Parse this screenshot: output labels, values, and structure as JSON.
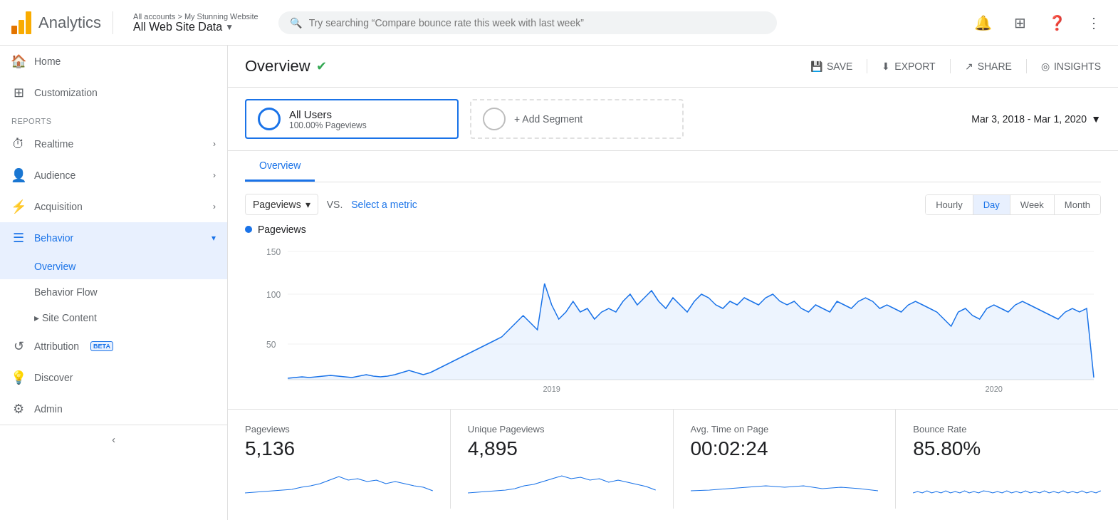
{
  "header": {
    "logo_text": "Analytics",
    "account_path": "All accounts > My Stunning Website",
    "account_name": "All Web Site Data",
    "search_placeholder": "Try searching “Compare bounce rate this week with last week”"
  },
  "sidebar": {
    "nav_items": [
      {
        "id": "home",
        "icon": "🏠",
        "label": "Home",
        "active": false
      },
      {
        "id": "customization",
        "icon": "⊞",
        "label": "Customization",
        "active": false
      }
    ],
    "reports_label": "REPORTS",
    "report_items": [
      {
        "id": "realtime",
        "icon": "⏱",
        "label": "Realtime",
        "expandable": true,
        "active": false
      },
      {
        "id": "audience",
        "icon": "👤",
        "label": "Audience",
        "expandable": true,
        "active": false
      },
      {
        "id": "acquisition",
        "icon": "⚡",
        "label": "Acquisition",
        "expandable": true,
        "active": false
      },
      {
        "id": "behavior",
        "icon": "☰",
        "label": "Behavior",
        "expandable": true,
        "active": true,
        "expanded": true
      }
    ],
    "behavior_sub": [
      {
        "id": "overview",
        "label": "Overview",
        "active": true
      },
      {
        "id": "behavior-flow",
        "label": "Behavior Flow",
        "active": false
      },
      {
        "id": "site-content",
        "label": "▸ Site Content",
        "active": false
      }
    ],
    "bottom_items": [
      {
        "id": "attribution",
        "icon": "↺",
        "label": "Attribution",
        "beta": true
      },
      {
        "id": "discover",
        "icon": "💡",
        "label": "Discover",
        "beta": false
      },
      {
        "id": "admin",
        "icon": "⚙",
        "label": "Admin",
        "beta": false
      }
    ],
    "collapse_label": "‹"
  },
  "overview": {
    "title": "Overview",
    "verified": true,
    "actions": {
      "save": "SAVE",
      "export": "EXPORT",
      "share": "SHARE",
      "insights": "INSIGHTS"
    }
  },
  "segment": {
    "name": "All Users",
    "pct": "100.00% Pageviews",
    "add_label": "+ Add Segment"
  },
  "date_range": "Mar 3, 2018 - Mar 1, 2020",
  "chart": {
    "tab": "Overview",
    "metric_label": "Pageviews",
    "vs_text": "VS.",
    "select_metric": "Select a metric",
    "legend": "Pageviews",
    "time_buttons": [
      "Hourly",
      "Day",
      "Week",
      "Month"
    ],
    "active_time": "Day",
    "y_labels": [
      "150",
      "100",
      "50"
    ],
    "x_labels": [
      "2019",
      "2020"
    ]
  },
  "stats": [
    {
      "label": "Pageviews",
      "value": "5,136"
    },
    {
      "label": "Unique Pageviews",
      "value": "4,895"
    },
    {
      "label": "Avg. Time on Page",
      "value": "00:02:24"
    },
    {
      "label": "Bounce Rate",
      "value": "85.80%"
    }
  ]
}
